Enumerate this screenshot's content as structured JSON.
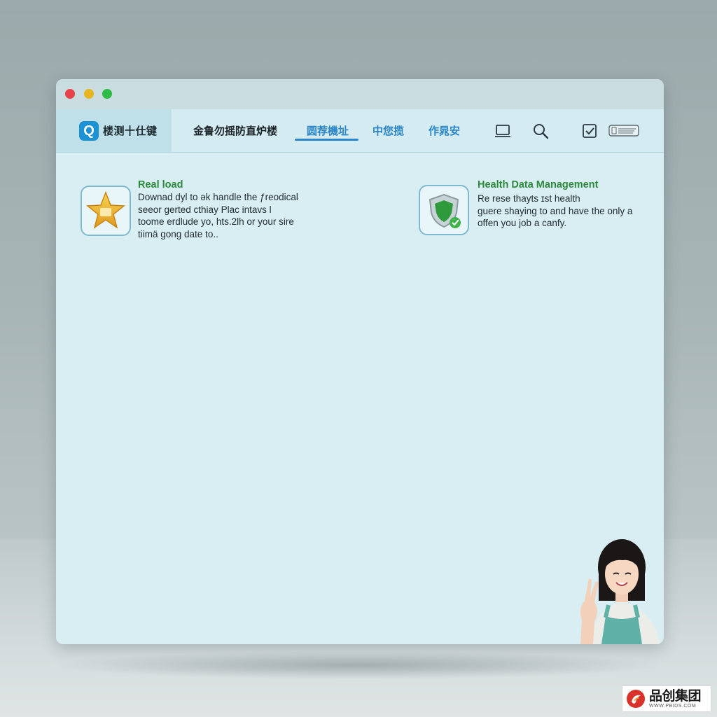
{
  "window": {
    "traffic_lights": [
      "close",
      "minimize",
      "maximize"
    ]
  },
  "navbar": {
    "brand_icon": "Q",
    "brand_name": "楼测十仕键",
    "title": "金鲁勿摇防直炉楼",
    "tabs": [
      {
        "label": "圆荐機址",
        "active": true
      },
      {
        "label": "中您揽",
        "active": false
      },
      {
        "label": "作晁安",
        "active": false
      }
    ],
    "icons": [
      "monitor-icon",
      "search-icon",
      "checkbox-icon",
      "badge-icon"
    ]
  },
  "cards": [
    {
      "icon": "star-icon",
      "title": "Real load",
      "body": [
        "Downad dyl to ək handle the ƒreodical",
        "seeor gerted cthiay Plac intavs l",
        "toome erdlude yo, hts.2lh or your sire",
        "tiimä gong date to.."
      ]
    },
    {
      "icon": "shield-check-icon",
      "title": "Health Data Management",
      "body": [
        "Re rese thayts ɪst health",
        "guere shaying to and have the only a",
        "offen you job a canfy."
      ]
    }
  ],
  "colors": {
    "accent": "#2a86c9",
    "card_title": "#2a8a3a",
    "window_bg": "#d9eef3",
    "brand_bg": "#bfe0e8"
  },
  "watermark": {
    "name": "品创集团",
    "url": "WWW.PBIDS.COM"
  }
}
